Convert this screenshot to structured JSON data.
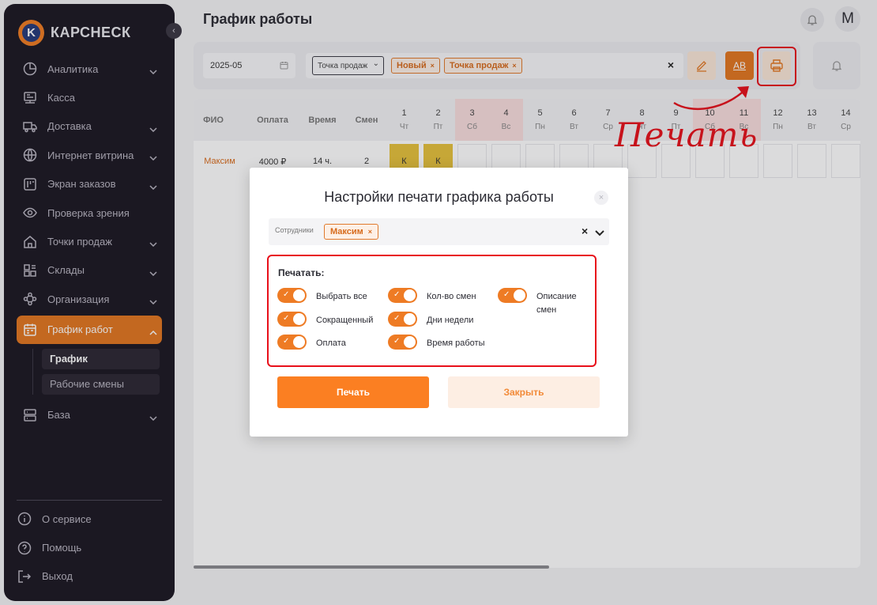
{
  "app": {
    "logo_text": "КАРСНЕСК",
    "logo_letter": "K"
  },
  "sidebar": {
    "collapse_glyph": "‹",
    "items": [
      {
        "label": "Аналитика",
        "icon": "chart-pie-icon",
        "has_chevron": true
      },
      {
        "label": "Касса",
        "icon": "cash-register-icon",
        "has_chevron": false
      },
      {
        "label": "Доставка",
        "icon": "truck-icon",
        "has_chevron": true
      },
      {
        "label": "Интернет витрина",
        "icon": "globe-icon",
        "has_chevron": true
      },
      {
        "label": "Экран заказов",
        "icon": "order-screen-icon",
        "has_chevron": true
      },
      {
        "label": "Проверка зрения",
        "icon": "eye-icon",
        "has_chevron": false
      },
      {
        "label": "Точки продаж",
        "icon": "store-icon",
        "has_chevron": true
      },
      {
        "label": "Склады",
        "icon": "warehouse-icon",
        "has_chevron": true
      },
      {
        "label": "Организация",
        "icon": "organization-icon",
        "has_chevron": true
      },
      {
        "label": "График работ",
        "icon": "calendar-icon",
        "has_chevron": true,
        "active": true
      },
      {
        "label": "База",
        "icon": "database-icon",
        "has_chevron": true
      }
    ],
    "subitems": [
      {
        "label": "График",
        "current": true
      },
      {
        "label": "Рабочие смены",
        "current": false
      }
    ],
    "bottom": [
      {
        "label": "О сервисе",
        "icon": "info-icon"
      },
      {
        "label": "Помощь",
        "icon": "help-icon"
      },
      {
        "label": "Выход",
        "icon": "logout-icon"
      }
    ]
  },
  "header": {
    "title": "График работы",
    "avatar_letter": "M"
  },
  "toolbar": {
    "date_value": "2025-05",
    "select_placeholder": "Точка продаж",
    "tags": [
      {
        "label": "Новый"
      },
      {
        "label": "Точка продаж"
      }
    ],
    "tag_remove": "×",
    "clear": "×",
    "ab_label": "АВ"
  },
  "table": {
    "headers": {
      "name": "ФИО",
      "payment": "Оплата",
      "time": "Время",
      "shifts": "Смен"
    },
    "days": [
      {
        "num": "1",
        "dow": "Чт",
        "weekend": false
      },
      {
        "num": "2",
        "dow": "Пт",
        "weekend": false
      },
      {
        "num": "3",
        "dow": "Сб",
        "weekend": true
      },
      {
        "num": "4",
        "dow": "Вс",
        "weekend": true
      },
      {
        "num": "5",
        "dow": "Пн",
        "weekend": false
      },
      {
        "num": "6",
        "dow": "Вт",
        "weekend": false
      },
      {
        "num": "7",
        "dow": "Ср",
        "weekend": false
      },
      {
        "num": "8",
        "dow": "Чт",
        "weekend": false
      },
      {
        "num": "9",
        "dow": "Пт",
        "weekend": false
      },
      {
        "num": "10",
        "dow": "Сб",
        "weekend": true
      },
      {
        "num": "11",
        "dow": "Вс",
        "weekend": true
      },
      {
        "num": "12",
        "dow": "Пн",
        "weekend": false
      },
      {
        "num": "13",
        "dow": "Вт",
        "weekend": false
      },
      {
        "num": "14",
        "dow": "Ср",
        "weekend": false
      }
    ],
    "rows": [
      {
        "name": "Максим",
        "payment": "4000 ₽",
        "time": "14 ч.",
        "shifts": "2",
        "cells": [
          "К",
          "К",
          "",
          "",
          "",
          "",
          "",
          "",
          "",
          "",
          "",
          "",
          "",
          ""
        ]
      }
    ]
  },
  "annotation": {
    "text": "Печать",
    "color": "#e8101a"
  },
  "modal": {
    "title": "Настройки печати графика работы",
    "close_glyph": "×",
    "employees_label": "Сотрудники",
    "employee_tag": "Максим",
    "tag_remove": "×",
    "clear": "×",
    "print_section_label": "Печатать:",
    "options": [
      {
        "label": "Выбрать все",
        "checked": true
      },
      {
        "label": "Сокращенный",
        "checked": true
      },
      {
        "label": "Оплата",
        "checked": true
      },
      {
        "label": "Кол-во смен",
        "checked": true
      },
      {
        "label": "Дни недели",
        "checked": true
      },
      {
        "label": "Время работы",
        "checked": true
      },
      {
        "label": "Описание смен",
        "checked": true
      }
    ],
    "print_button": "Печать",
    "close_button": "Закрыть"
  },
  "colors": {
    "accent": "#e37620",
    "button": "#fb7f22",
    "highlight": "#e8101a",
    "sidebar_bg": "#1b1722"
  }
}
